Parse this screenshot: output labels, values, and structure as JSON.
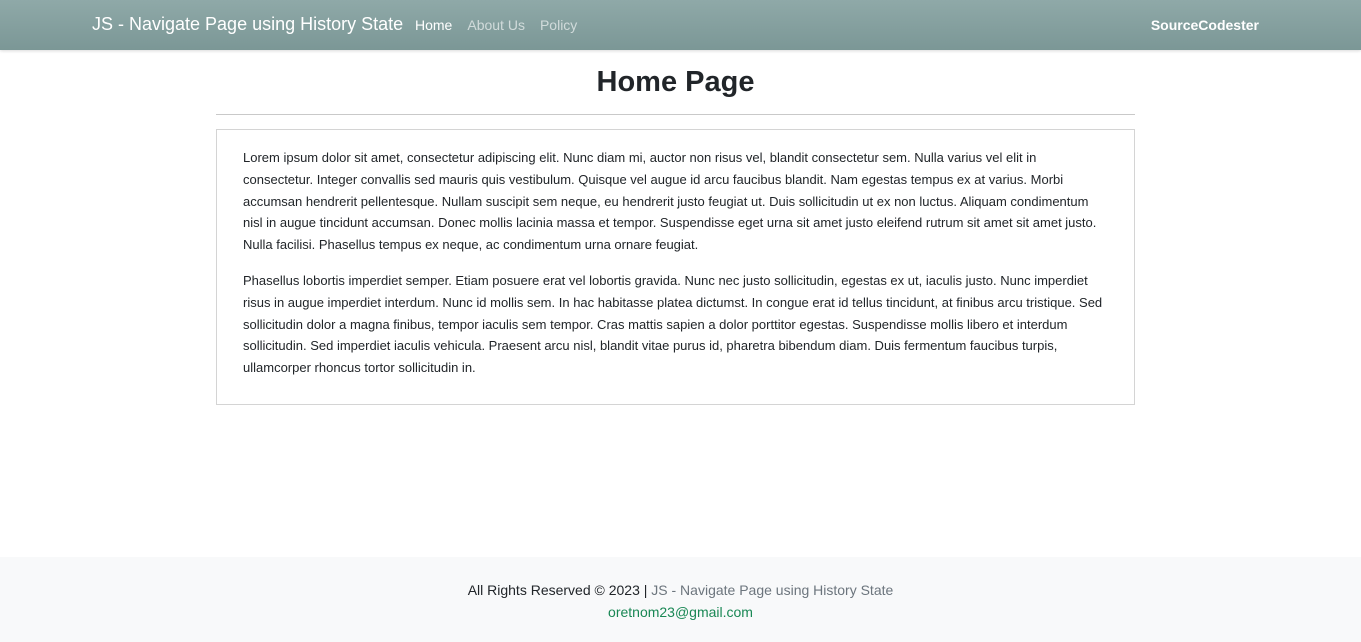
{
  "navbar": {
    "brand": "JS - Navigate Page using History State",
    "links": [
      {
        "label": "Home",
        "active": true
      },
      {
        "label": "About Us",
        "active": false
      },
      {
        "label": "Policy",
        "active": false
      }
    ],
    "right_brand": "SourceCodester",
    "colors": {
      "background": "#7f9b9a",
      "text": "#ffffff"
    }
  },
  "main": {
    "title": "Home Page",
    "paragraphs": [
      "Lorem ipsum dolor sit amet, consectetur adipiscing elit. Nunc diam mi, auctor non risus vel, blandit consectetur sem. Nulla varius vel elit in consectetur. Integer convallis sed mauris quis vestibulum. Quisque vel augue id arcu faucibus blandit. Nam egestas tempus ex at varius. Morbi accumsan hendrerit pellentesque. Nullam suscipit sem neque, eu hendrerit justo feugiat ut. Duis sollicitudin ut ex non luctus. Aliquam condimentum nisl in augue tincidunt accumsan. Donec mollis lacinia massa et tempor. Suspendisse eget urna sit amet justo eleifend rutrum sit amet sit amet justo. Nulla facilisi. Phasellus tempus ex neque, ac condimentum urna ornare feugiat.",
      "Phasellus lobortis imperdiet semper. Etiam posuere erat vel lobortis gravida. Nunc nec justo sollicitudin, egestas ex ut, iaculis justo. Nunc imperdiet risus in augue imperdiet interdum. Nunc id mollis sem. In hac habitasse platea dictumst. In congue erat id tellus tincidunt, at finibus arcu tristique. Sed sollicitudin dolor a magna finibus, tempor iaculis sem tempor. Cras mattis sapien a dolor porttitor egestas. Suspendisse mollis libero et interdum sollicitudin. Sed imperdiet iaculis vehicula. Praesent arcu nisl, blandit vitae purus id, pharetra bibendum diam. Duis fermentum faucibus turpis, ullamcorper rhoncus tortor sollicitudin in."
    ]
  },
  "footer": {
    "rights_text": "All Rights Reserved © 2023 | ",
    "app_name": "JS - Navigate Page using History State",
    "email": "oretnom23@gmail.com",
    "colors": {
      "background": "#f8f9fa",
      "email": "#198754",
      "app_name": "#6c757d"
    }
  }
}
